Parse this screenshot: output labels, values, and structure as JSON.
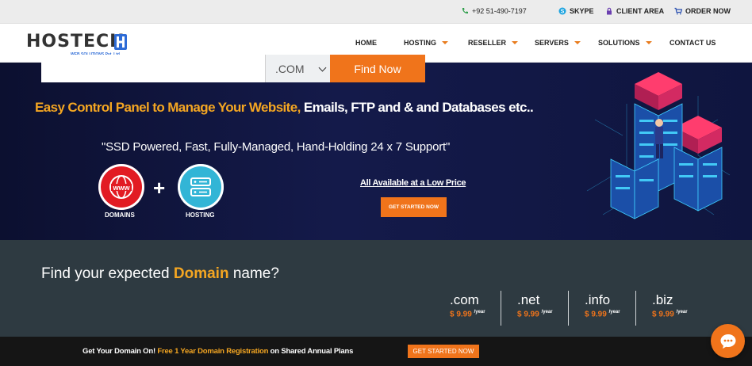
{
  "topbar": {
    "phone": "+92 51-490-7197",
    "skype": "SKYPE",
    "client_area": "CLIENT AREA",
    "order_now": "ORDER NOW"
  },
  "brand": {
    "name": "HOSTECH",
    "subtitle": "WEB SOLUTIONS Pvt. Ltd."
  },
  "nav": {
    "items": [
      {
        "label": "HOME",
        "dropdown": false
      },
      {
        "label": "HOSTING",
        "dropdown": true
      },
      {
        "label": "RESELLER",
        "dropdown": true
      },
      {
        "label": "SERVERS",
        "dropdown": true
      },
      {
        "label": "SOLUTIONS",
        "dropdown": true
      },
      {
        "label": "CONTACT US",
        "dropdown": false
      }
    ]
  },
  "hero": {
    "headline_part1": "Easy Control Panel to Manage  Your Website,",
    "headline_part2": " Emails,  FTP and  & and Databases etc..",
    "tagline": "\"SSD Powered,  Fast,  Fully-Managed,  Hand-Holding 24 x 7 Support\"",
    "domains_label": "DOMAINS",
    "hosting_label": "HOSTING",
    "plus": "+",
    "low_price": "All Available at a Low Price",
    "cta": "GET STARTED NOW"
  },
  "domain_search": {
    "title_prefix": "Find your expected ",
    "title_highlight": "Domain",
    "title_suffix": " name?",
    "input_value": "",
    "tld_selected": ".COM",
    "button": "Find Now",
    "prices": [
      {
        "ext": ".com",
        "price": "$ 9.99",
        "period": "/year"
      },
      {
        "ext": ".net",
        "price": "$ 9.99",
        "period": "/year"
      },
      {
        "ext": ".info",
        "price": "$ 9.99",
        "period": "/year"
      },
      {
        "ext": ".biz",
        "price": "$ 9.99",
        "period": "/year"
      }
    ]
  },
  "promo_bar": {
    "text_prefix": "Get Your Domain On! ",
    "text_highlight": "Free 1 Year Domain Registration",
    "text_suffix": " on Shared Annual Plans",
    "button": "GET STARTED NOW"
  },
  "colors": {
    "accent": "#f0741b",
    "headline_orange": "#f4a622",
    "hero_bg": "#111745",
    "search_bg": "#2e3a41",
    "bottom_bg": "#151515"
  }
}
